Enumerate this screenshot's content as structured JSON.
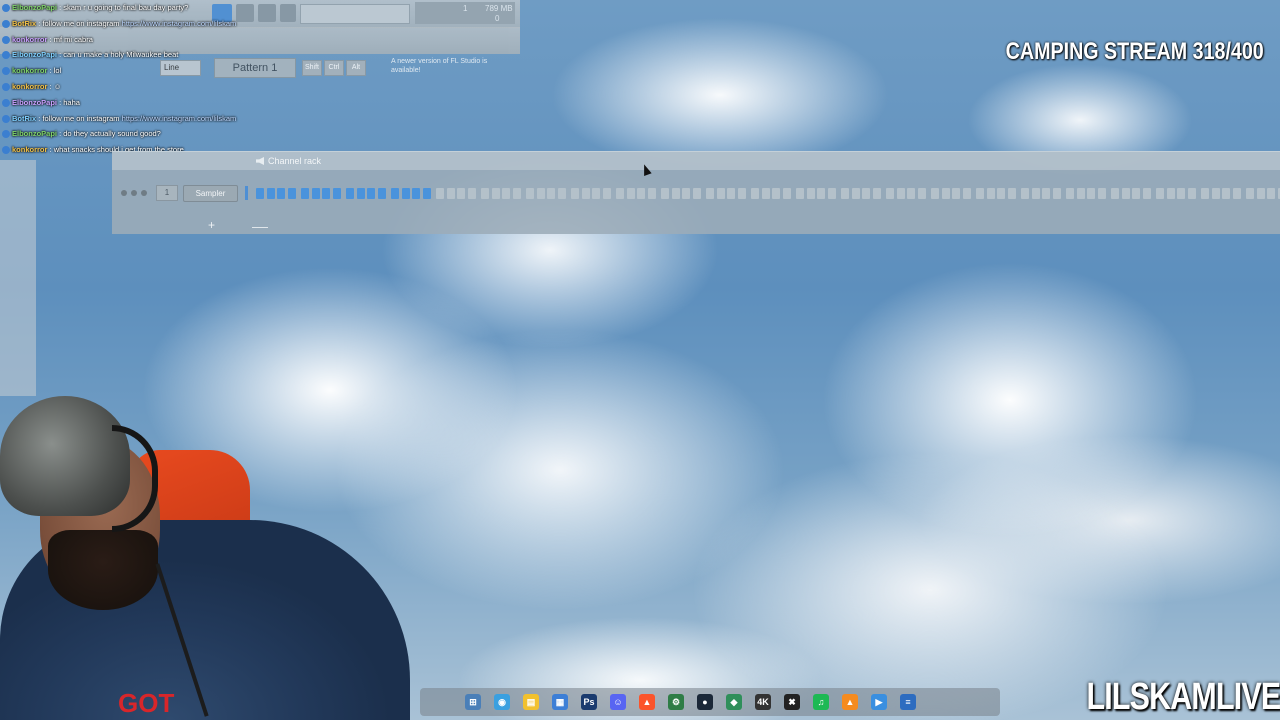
{
  "fl_studio": {
    "toolbar": {
      "tempo_values": [
        "1",
        "789 MB",
        "0"
      ],
      "snap_mode": "Line",
      "pattern_label": "Pattern 1",
      "buttons": [
        "Shift",
        "Ctrl",
        "Alt"
      ],
      "update_notice": "A newer version of FL Studio is available!"
    },
    "channel_rack": {
      "title": "Channel rack",
      "channel_number": "1",
      "channel_name": "Sampler",
      "add_label": "+",
      "lit_steps": 16,
      "total_steps": 96,
      "accent_color": "#4a93dc"
    }
  },
  "chat": [
    {
      "user": "ElbonzoPapi",
      "message": "skam r u going to final bau day party?",
      "badge": true
    },
    {
      "user": "BotRix",
      "message": "follow me on instagram",
      "link": "https://www.instagram.com/lilskam",
      "badge": true
    },
    {
      "user": "konkorror",
      "message": "mf mi cabra",
      "badge": true
    },
    {
      "user": "ElbonzoPapi",
      "message": "can u make a holy Milwaukee beat",
      "badge": true
    },
    {
      "user": "konkorror",
      "message": "lol",
      "badge": true
    },
    {
      "user": "konkorror",
      "message": "",
      "emote": true,
      "badge": true
    },
    {
      "user": "ElbonzoPapi",
      "message": "haha",
      "badge": true
    },
    {
      "user": "BotRix",
      "message": "follow me on instagram",
      "link": "https://www.instagram.com/lilskam",
      "badge": true
    },
    {
      "user": "ElbonzoPapi",
      "message": "do they actually sound good?",
      "badge": true
    },
    {
      "user": "konkorror",
      "message": "what snacks should i get from the store",
      "badge": true
    }
  ],
  "overlay": {
    "stream_title": "CAMPING STREAM 318/400",
    "channel_name": "LILSKAMLIVE",
    "hoodie_text": "GOT"
  },
  "taskbar": {
    "icons": [
      "windows-icon",
      "copilot-icon",
      "file-explorer-icon",
      "store-icon",
      "photoshop-icon",
      "discord-icon",
      "brave-icon",
      "app-icon",
      "steam-icon",
      "app-icon-2",
      "4k-icon",
      "capcut-icon",
      "spotify-icon",
      "fl-studio-icon",
      "app-icon-3",
      "notepad-icon"
    ]
  }
}
